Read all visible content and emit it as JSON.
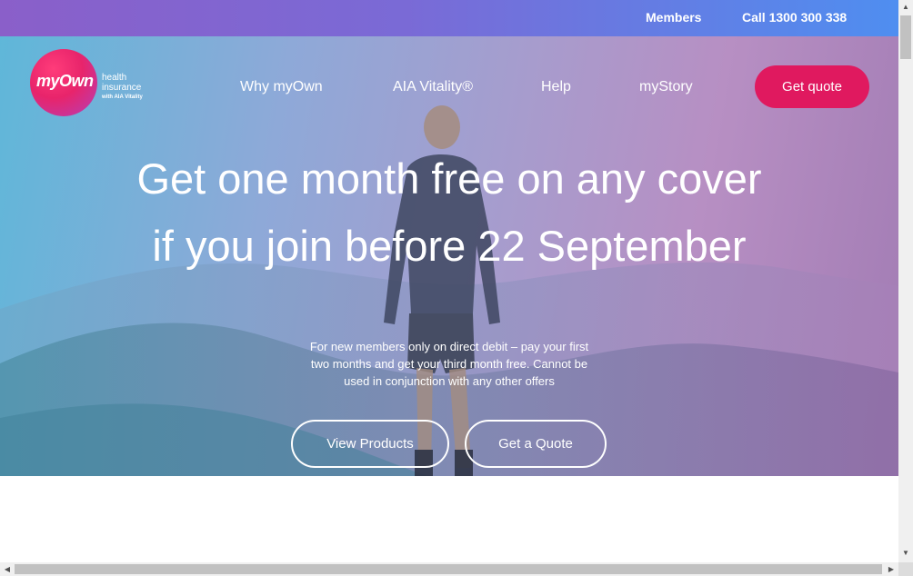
{
  "topbar": {
    "members_label": "Members",
    "call_label": "Call 1300 300 338"
  },
  "logo": {
    "brand": "myOwn",
    "line1": "health",
    "line2": "insurance",
    "line3": "with AIA Vitality"
  },
  "nav": {
    "items": [
      {
        "label": "Why myOwn"
      },
      {
        "label": "AIA Vitality®"
      },
      {
        "label": "Help"
      },
      {
        "label": "myStory"
      }
    ],
    "cta_label": "Get quote"
  },
  "hero": {
    "headline_line1": "Get one month free on any cover",
    "headline_line2": "if you join before 22 September",
    "subtext": "For new members only on direct debit – pay your first two months and get your third month free. Cannot be used in conjunction with any other offers",
    "view_products_label": "View Products",
    "get_quote_label": "Get a Quote"
  },
  "colors": {
    "accent": "#e0195f",
    "topbar_start": "#8a5fc9",
    "topbar_end": "#4f8ef0"
  },
  "icons": {
    "scroll_up": "triangle-up-icon",
    "scroll_down": "triangle-down-icon",
    "scroll_left": "triangle-left-icon",
    "scroll_right": "triangle-right-icon"
  }
}
